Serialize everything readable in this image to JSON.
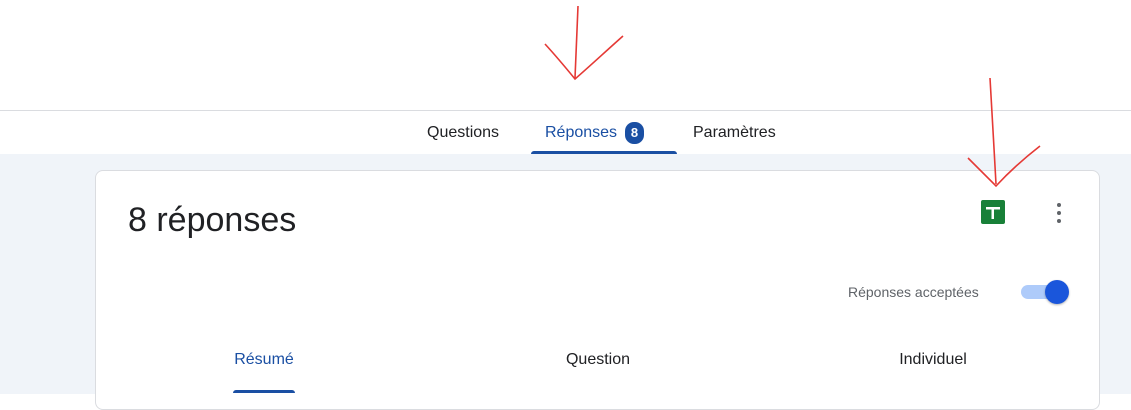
{
  "tabs": [
    {
      "label": "Questions",
      "active": false
    },
    {
      "label": "Réponses",
      "active": true,
      "badge": "8"
    },
    {
      "label": "Paramètres",
      "active": false
    }
  ],
  "card": {
    "title": "8 réponses",
    "sheets_icon": "google-sheets-icon",
    "more_icon": "more-vert-icon",
    "accepting_label": "Réponses acceptées",
    "accepting_enabled": true
  },
  "subtabs": [
    {
      "label": "Résumé",
      "active": true
    },
    {
      "label": "Question",
      "active": false
    },
    {
      "label": "Individuel",
      "active": false
    }
  ],
  "colors": {
    "accent": "#1a4fa3",
    "sheets_green": "#188038",
    "annotation_red": "#e53935",
    "page_background": "#f0f4f9"
  }
}
